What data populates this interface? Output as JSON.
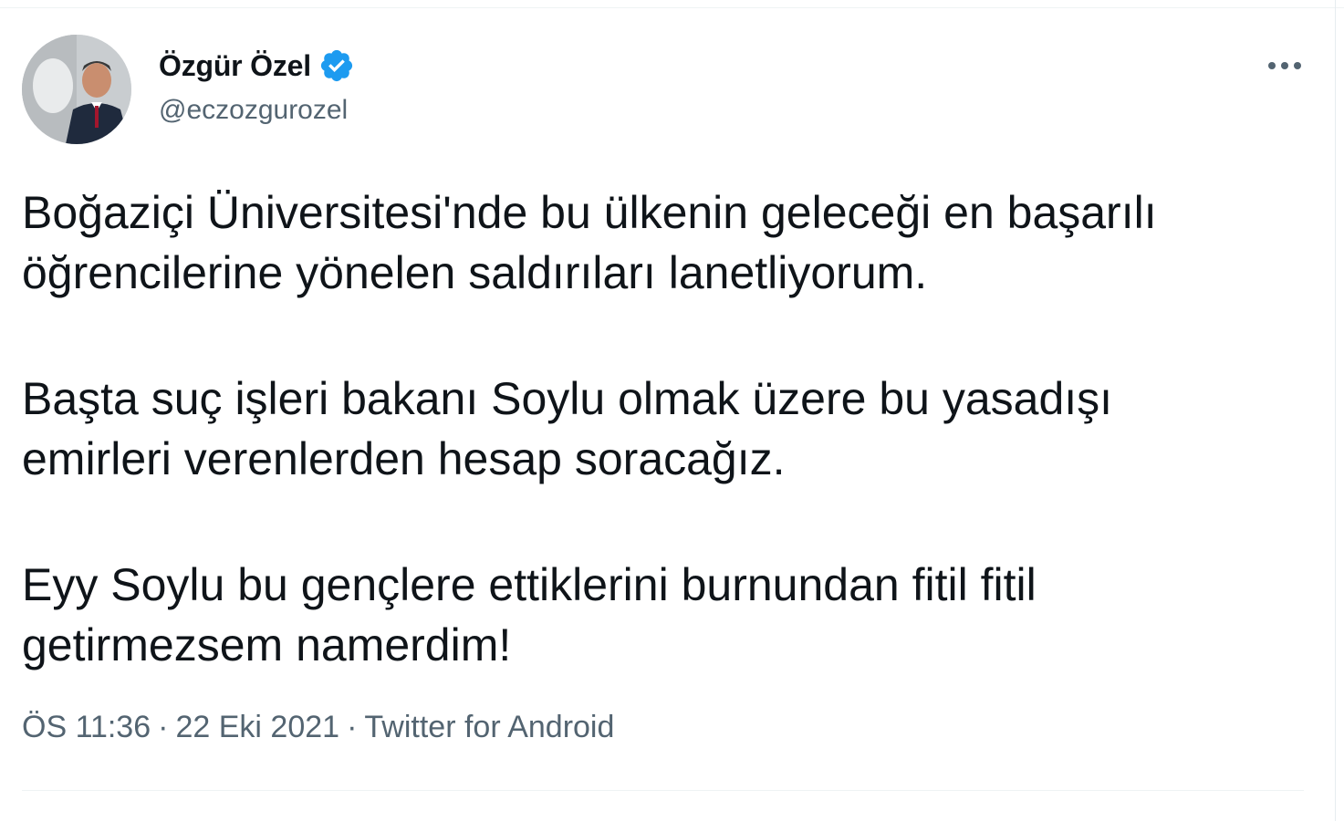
{
  "author": {
    "display_name": "Özgür Özel",
    "handle": "@eczozgurozel",
    "verified": true,
    "avatar_icon": "avatar-photo"
  },
  "menu": {
    "more_icon": "more-horizontal-icon"
  },
  "tweet": {
    "paragraphs": [
      "Boğaziçi Üniversitesi'nde bu ülkenin geleceği en başarılı\nöğrencilerine yönelen saldırıları lanetliyorum.",
      "Başta suç işleri bakanı Soylu olmak üzere bu yasadışı\nemirleri verenlerden hesap soracağız.",
      "Eyy Soylu bu gençlere ettiklerini burnundan fitil fitil\ngetirmezsem namerdim!"
    ],
    "time": "ÖS 11:36",
    "date": "22 Eki 2021",
    "separator": "·",
    "source": "Twitter for Android"
  },
  "colors": {
    "verified_blue": "#1d9bf0",
    "text_primary": "#0f1419",
    "text_secondary": "#536471"
  }
}
